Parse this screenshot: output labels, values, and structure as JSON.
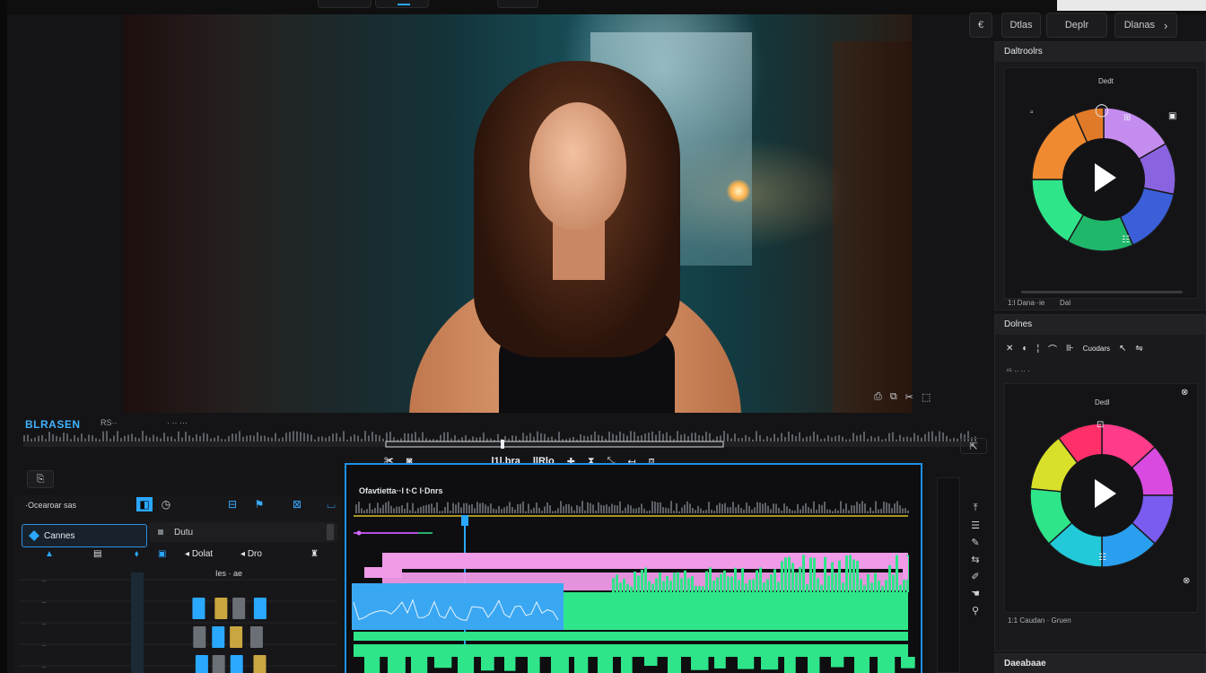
{
  "preview": {
    "overlay_icons": [
      "⎙",
      "⧉",
      "✂",
      "⬚"
    ]
  },
  "scrubber": {
    "label": "BLRASEN",
    "meta1": "RS··",
    "meta2": "· ·· ···"
  },
  "transport": {
    "timecode1": "l1l.bra",
    "timecode2": "llRlo"
  },
  "bin": {
    "header": "·Ocearoar sas",
    "tab": "Cannes",
    "search_label": "Dutu",
    "column1": "Dolat",
    "column2": "Dro",
    "sub": "Ies · ae"
  },
  "timeline": {
    "title": "Ofavtietta··l t·C l·Dnrs"
  },
  "right": {
    "panel1_title": "Daltroolrs",
    "panel1_wheel_label": "Dedt",
    "panel1_foot": "1:l Dana··ie",
    "panel1_foot2": "Dal",
    "panel2_title": "Dolnes",
    "panel2_wheel_label": "Dedl",
    "panel2_controls_label": "Cuodars",
    "panel2_sub": "⁴⁵ ·· ·· ·",
    "panel2_foot": "1:1 Caudan · Gruen",
    "panel3_title": "Daeabaae"
  },
  "toprow": {
    "back": "€",
    "b1": "Dtlas",
    "b2": "Deplr",
    "b3": "Dlanas"
  },
  "colors": {
    "accent": "#2aa8ff",
    "timeline_border": "#1f90e8",
    "green_clip": "#2fe58a",
    "pink_clip": "#f09ae8",
    "blue_clip": "#3aa7f2"
  }
}
